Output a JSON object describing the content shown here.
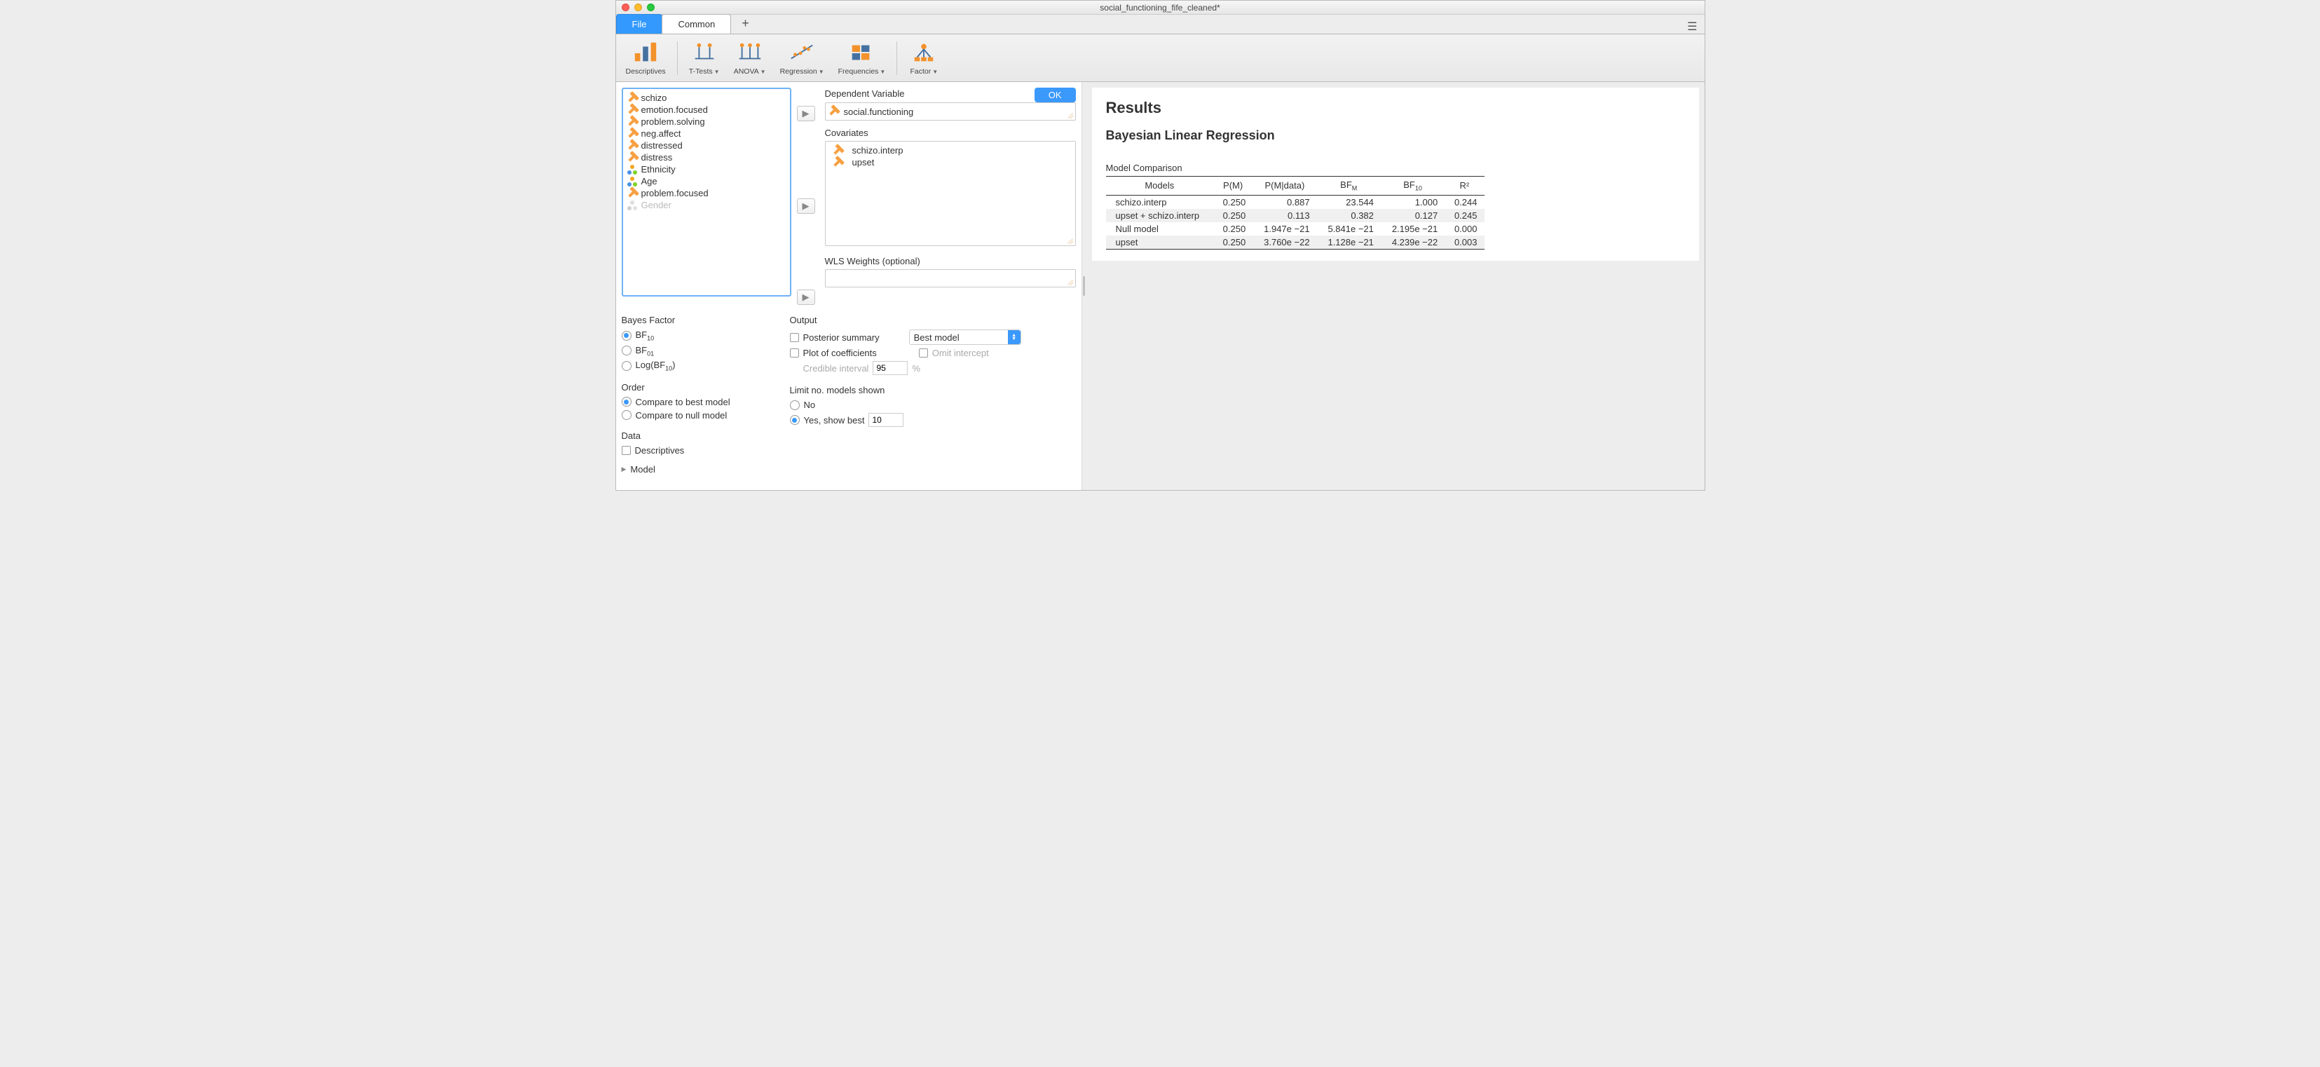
{
  "window_title": "social_functioning_fife_cleaned*",
  "tabs": {
    "file": "File",
    "common": "Common"
  },
  "ribbon": {
    "descriptives": "Descriptives",
    "ttests": "T-Tests",
    "anova": "ANOVA",
    "regression": "Regression",
    "frequencies": "Frequencies",
    "factor": "Factor"
  },
  "variables": [
    {
      "name": "schizo",
      "type": "scale"
    },
    {
      "name": "emotion.focused",
      "type": "scale"
    },
    {
      "name": "problem.solving",
      "type": "scale"
    },
    {
      "name": "neg.affect",
      "type": "scale"
    },
    {
      "name": "distressed",
      "type": "scale"
    },
    {
      "name": "distress",
      "type": "scale"
    },
    {
      "name": "Ethnicity",
      "type": "nominal"
    },
    {
      "name": "Age",
      "type": "nominal"
    },
    {
      "name": "problem.focused",
      "type": "scale"
    },
    {
      "name": "Gender",
      "type": "ghost-nominal"
    }
  ],
  "field_labels": {
    "dependent": "Dependent Variable",
    "covariates": "Covariates",
    "wls": "WLS Weights (optional)"
  },
  "dependent_value": "social.functioning",
  "covariate_values": [
    "upset",
    "schizo.interp"
  ],
  "ok_label": "OK",
  "options": {
    "bayes_factor_heading": "Bayes Factor",
    "bf10": "BF",
    "bf10_sub": "10",
    "bf01": "BF",
    "bf01_sub": "01",
    "logbf": "Log(BF",
    "logbf_sub": "10",
    "logbf_close": ")",
    "order_heading": "Order",
    "compare_best": "Compare to best model",
    "compare_null": "Compare to null model",
    "data_heading": "Data",
    "descriptives": "Descriptives",
    "model_heading": "Model",
    "output_heading": "Output",
    "posterior_summary": "Posterior summary",
    "best_model": "Best model",
    "plot_coef": "Plot of coefficients",
    "omit_intercept": "Omit intercept",
    "credible_interval": "Credible interval",
    "credible_value": "95",
    "percent": "%",
    "limit_heading": "Limit no. models shown",
    "no_label": "No",
    "yes_label": "Yes, show best",
    "yes_value": "10"
  },
  "results": {
    "title": "Results",
    "analysis": "Bayesian Linear Regression",
    "table_caption": "Model Comparison",
    "headers": {
      "models": "Models",
      "pm": "P(M)",
      "pmdata": "P(M|data)",
      "bfm": "BF",
      "bfm_sub": "M",
      "bf10": "BF",
      "bf10_sub": "10",
      "r2": "R²"
    },
    "rows": [
      {
        "model": "schizo.interp",
        "pm": "0.250",
        "pmdata": "0.887",
        "bfm": "23.544",
        "bf10": "1.000",
        "r2": "0.244"
      },
      {
        "model": "upset + schizo.interp",
        "pm": "0.250",
        "pmdata": "0.113",
        "bfm": "0.382",
        "bf10": "0.127",
        "r2": "0.245"
      },
      {
        "model": "Null model",
        "pm": "0.250",
        "pmdata": "1.947e −21",
        "bfm": "5.841e −21",
        "bf10": "2.195e −21",
        "r2": "0.000"
      },
      {
        "model": "upset",
        "pm": "0.250",
        "pmdata": "3.760e −22",
        "bfm": "1.128e −21",
        "bf10": "4.239e −22",
        "r2": "0.003"
      }
    ]
  }
}
